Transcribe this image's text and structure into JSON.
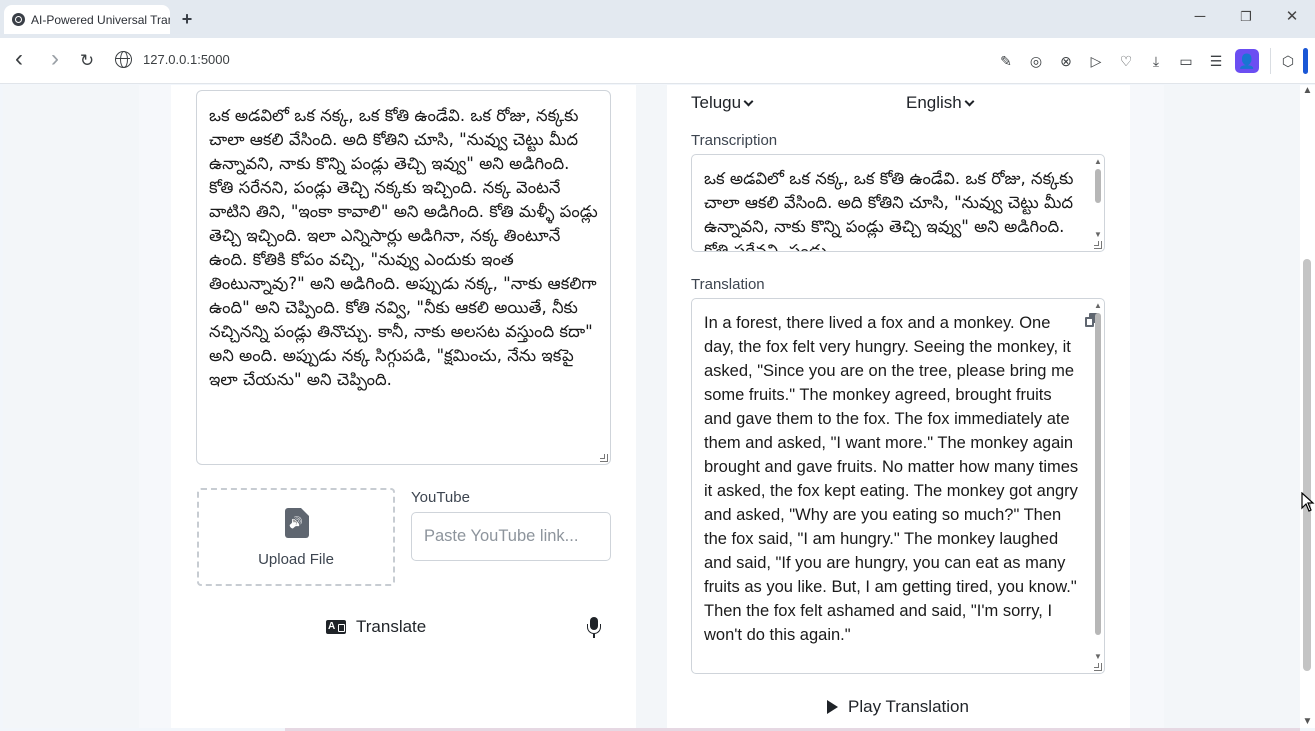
{
  "browser": {
    "tab_title": "AI-Powered Universal Tran",
    "url": "127.0.0.1:5000",
    "window_controls": {
      "minimize": "─",
      "restore": "❐",
      "close": "✕"
    },
    "nav": {
      "back": "‹",
      "forward": "›",
      "reload": "↻"
    },
    "toolbar_icons": [
      "edit-icon",
      "camera-icon",
      "shield-icon",
      "send-icon",
      "heart-icon",
      "download-icon",
      "reader-icon",
      "menu-icon",
      "profile-icon",
      "cube-icon"
    ]
  },
  "input": {
    "source_text": "ఒక అడవిలో ఒక నక్క, ఒక కోతి ఉండేవి. ఒక రోజు, నక్కకు చాలా ఆకలి వేసింది. అది కోతిని చూసి, \"నువ్వు చెట్టు మీద ఉన్నావని, నాకు కొన్ని పండ్లు తెచ్చి ఇవ్వు\" అని అడిగింది. కోతి సరేనని, పండ్లు తెచ్చి నక్కకు ఇచ్చింది. నక్క వెంటనే వాటిని తిని, \"ఇంకా కావాలి\" అని అడిగింది. కోతి మళ్ళీ పండ్లు తెచ్చి ఇచ్చింది. ఇలా ఎన్నిసార్లు అడిగినా, నక్క తింటూనే ఉంది. కోతికి కోపం వచ్చి, \"నువ్వు ఎందుకు ఇంత తింటున్నావు?\" అని అడిగింది. అప్పుడు నక్క, \"నాకు ఆకలిగా ఉంది\" అని చెప్పింది. కోతి నవ్వి, \"నీకు ఆకలి అయితే, నీకు నచ్చినన్ని పండ్లు తినొచ్చు. కానీ, నాకు అలసట వస్తుంది కదా\" అని అంది. అప్పుడు నక్క సిగ్గుపడి, \"క్షమించు, నేను ఇకపై ఇలా చేయను\" అని చెప్పింది.",
    "upload_label": "Upload File",
    "youtube_label": "YouTube",
    "youtube_placeholder": "Paste YouTube link...",
    "translate_label": "Translate"
  },
  "output": {
    "source_language": "Telugu",
    "target_language": "English",
    "transcription_label": "Transcription",
    "transcription_text": "ఒక అడవిలో ఒక నక్క, ఒక కోతి ఉండేవి. ఒక రోజు, నక్కకు చాలా ఆకలి వేసింది. అది కోతిని చూసి, \"నువ్వు చెట్టు మీద ఉన్నావని, నాకు కొన్ని పండ్లు తెచ్చి ఇవ్వు\" అని అడిగింది. కోతి సరేనని, పండ్లు",
    "translation_label": "Translation",
    "translation_text": "In a forest, there lived a fox and a monkey. One day, the fox felt very hungry. Seeing the monkey, it asked, \"Since you are on the tree, please bring me some fruits.\" The monkey agreed, brought fruits and gave them to the fox. The fox immediately ate them and asked, \"I want more.\" The monkey again brought and gave fruits.  No matter how many times it asked, the fox kept eating. The monkey got angry and asked, \"Why are you eating so much?\" Then the fox said, \"I am hungry.\" The monkey laughed and said, \"If you are hungry, you can eat as many fruits as you like. But, I am getting tired, you know.\" Then the fox felt ashamed and said, \"I'm sorry, I won't do this again.\"",
    "play_label": "Play Translation"
  }
}
